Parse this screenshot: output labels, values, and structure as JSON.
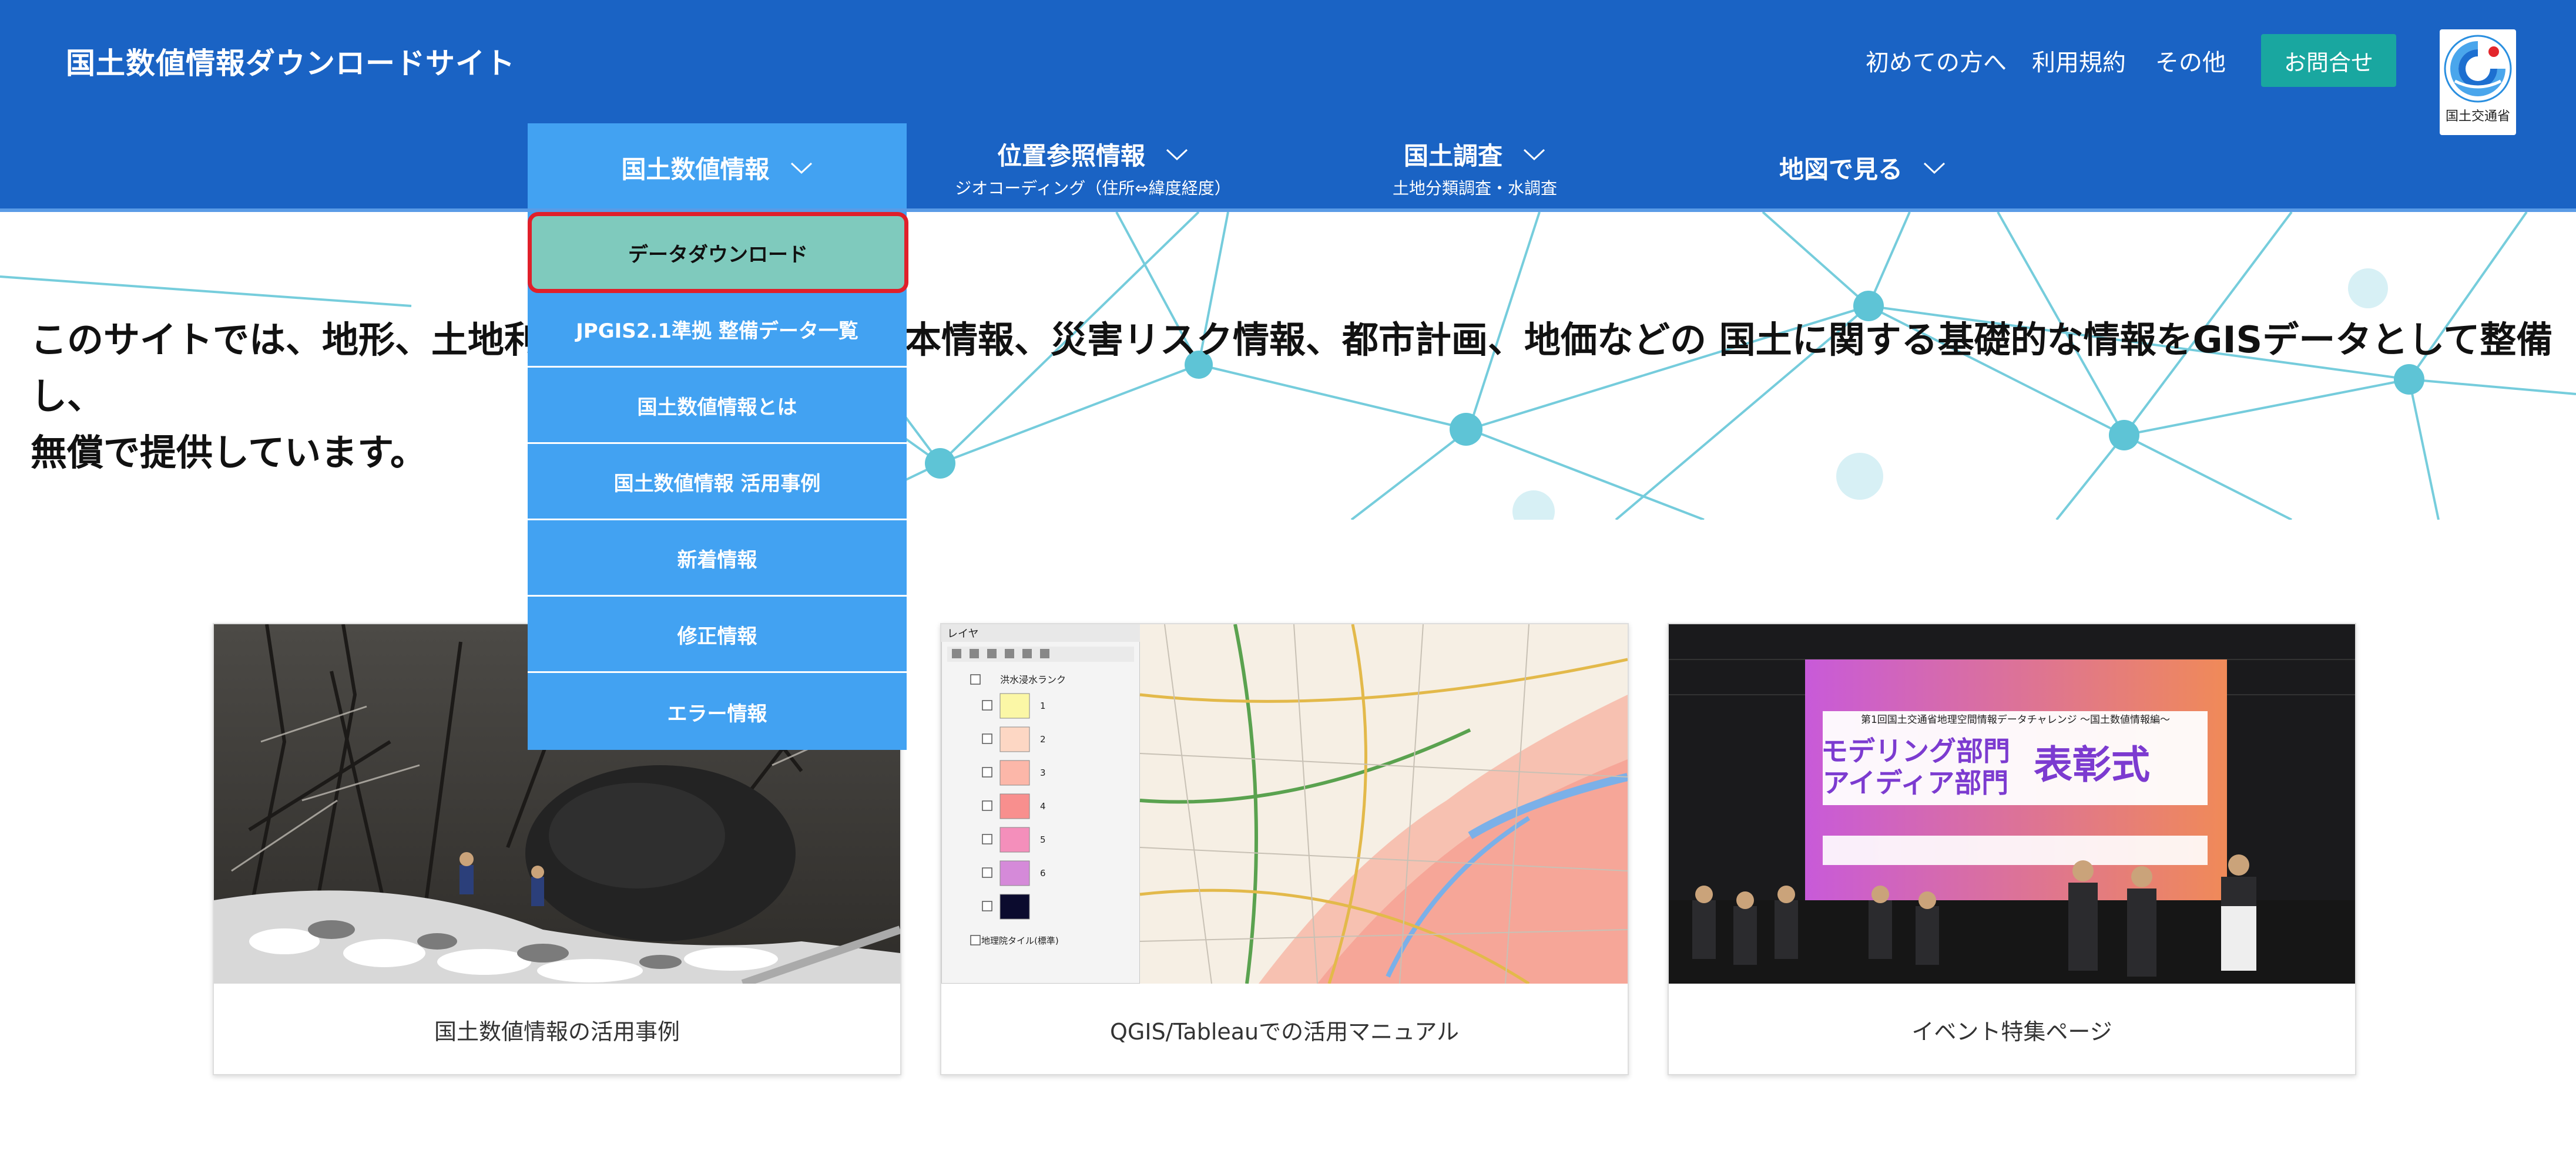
{
  "header": {
    "site_title": "国土数値情報ダウンロードサイト",
    "links": {
      "first_time": "初めての方へ",
      "terms": "利用規約",
      "other": "その他"
    },
    "contact_label": "お問合せ",
    "logo_text": "国土交通省"
  },
  "nav": {
    "kokudo": {
      "label": "国土数値情報"
    },
    "ichi": {
      "label": "位置参照情報",
      "sub": "ジオコーディング（住所⇔緯度経度）"
    },
    "chousa": {
      "label": "国土調査",
      "sub": "土地分類調査・水調査"
    },
    "map": {
      "label": "地図で見る"
    }
  },
  "dropdown": {
    "items": [
      {
        "label": "データダウンロード"
      },
      {
        "label": "JPGIS2.1準拠 整備データ一覧"
      },
      {
        "label": "国土数値情報とは"
      },
      {
        "label": "国土数値情報 活用事例"
      },
      {
        "label": "新着情報"
      },
      {
        "label": "修正情報"
      },
      {
        "label": "エラー情報"
      }
    ]
  },
  "hero": {
    "text_line1": "このサイトでは、地形、土地利用、公共施設などの基本情報、災害リスク情報、都市計画、地価などの 国土に関する基礎的な情報をGISデータとして整備し、",
    "text_line2": "無償で提供しています。"
  },
  "cards": [
    {
      "label": "国土数値情報の活用事例"
    },
    {
      "label": "QGIS/Tableauでの活用マニュアル"
    },
    {
      "label": "イベント特集ページ"
    }
  ],
  "card2_image": {
    "panel_title": "レイヤ",
    "group_label": "洪水浸水ランク",
    "legend": [
      "1",
      "2",
      "3",
      "4",
      "5",
      "6"
    ],
    "tile_label": "地理院タイル(標準)",
    "legend_colors": [
      "#fbf7a6",
      "#fdd7c4",
      "#fcb7a9",
      "#f88f8e",
      "#f48fbb",
      "#d58ad9",
      "#0b0b2e"
    ]
  },
  "card3_image": {
    "banner_title": "第1回国土交通省地理空間情報データチャレンジ ～国土数値情報編～",
    "banner_main_1": "モデリング部門",
    "banner_main_2": "アイディア部門",
    "banner_main_3": "表彰式"
  },
  "colors": {
    "header_bg": "#1a63c4",
    "nav_active": "#42a2f2",
    "contact_bg": "#19a7a0",
    "dropdown_active": "#7fcabd",
    "highlight_border": "#e01f2a"
  }
}
